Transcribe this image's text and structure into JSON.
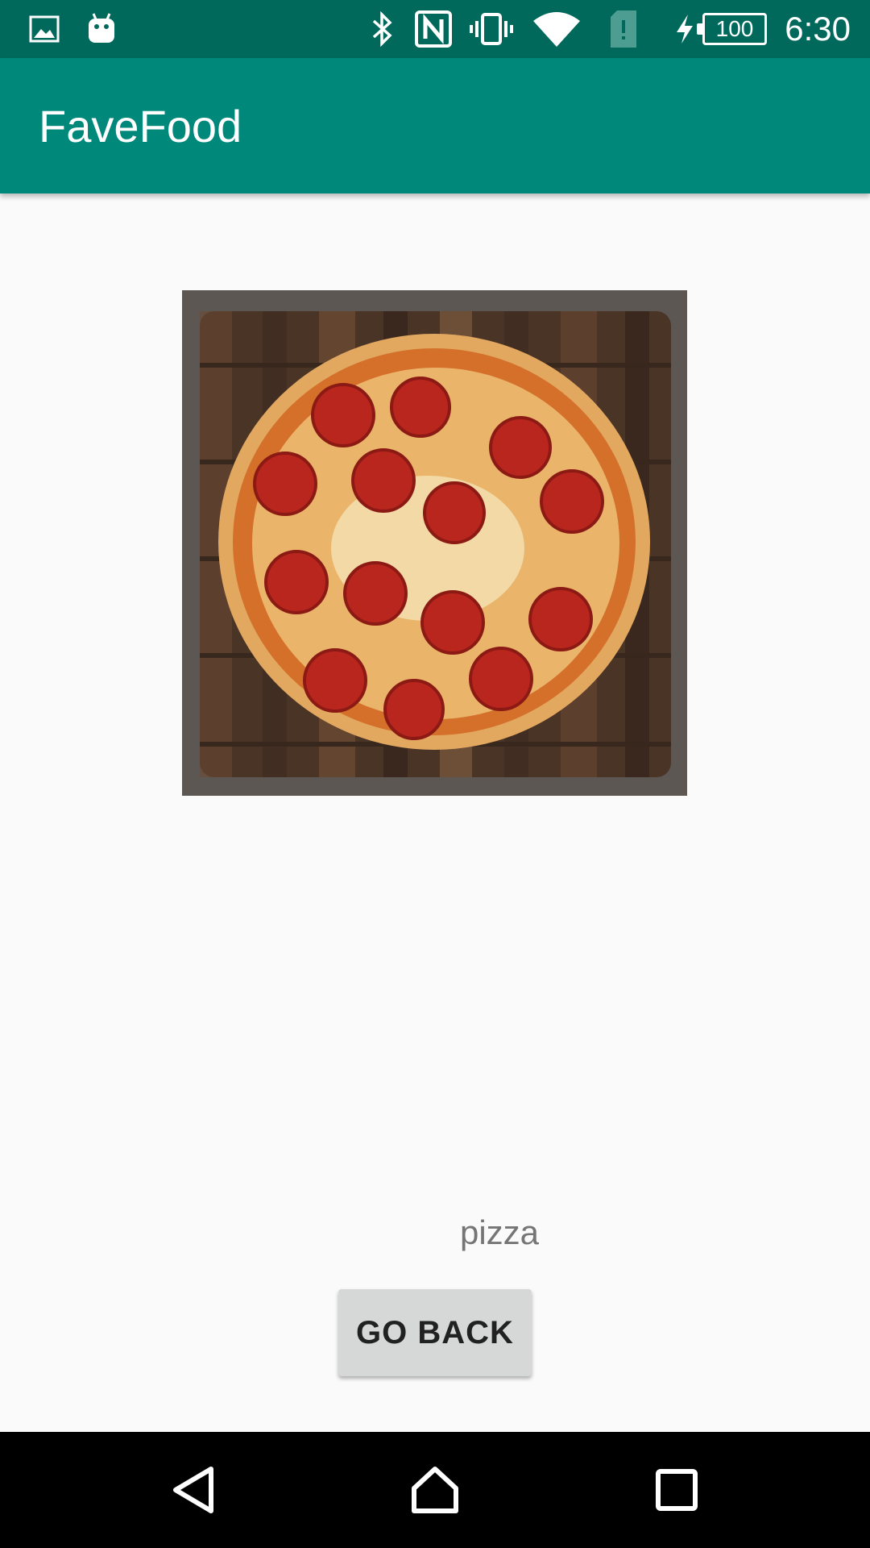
{
  "status_bar": {
    "time": "6:30",
    "battery": "100",
    "icons": [
      "image-icon",
      "android-icon",
      "bluetooth-icon",
      "nfc-icon",
      "vibrate-icon",
      "wifi-icon",
      "sim-alert-icon",
      "charging-icon",
      "battery-icon"
    ]
  },
  "app_bar": {
    "title": "FaveFood"
  },
  "main": {
    "image_icon": "pizza-image",
    "food_name": "pizza",
    "back_button": "GO BACK"
  },
  "nav_bar": {
    "icons": [
      "back-icon",
      "home-icon",
      "recents-icon"
    ]
  },
  "colors": {
    "status_bar": "#00695c",
    "app_bar": "#00897b",
    "background": "#fafafa",
    "button": "#d6d7d7"
  }
}
